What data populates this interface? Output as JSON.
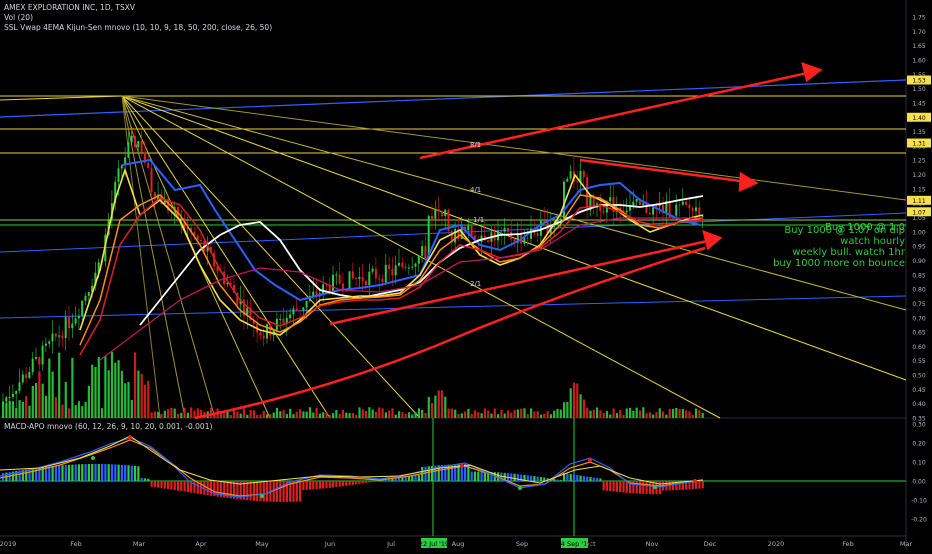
{
  "header": {
    "symbol": "AMEX EXPLORATION INC, 1D, TSXV",
    "vol": "Vol (20)",
    "ssl": "SSL Vwap 4EMA Kijun-Sen mnovo (10, 10, 9, 18, 50, 200, close, 26, 50)",
    "macd": "MACD-APO mnovo (60, 12, 26, 9, 10, 20, 0.001, -0.001)"
  },
  "annotations": {
    "line1": "Buy 1000 @ 1.0",
    "line2": "Buy 1000 @ 1.07 on dip",
    "line3": "watch hourly",
    "line4": "weekly bull. watch 1hr",
    "line5": "buy 1000 more on bounce",
    "fan_8_1": "8/1",
    "fan_4_1": "4/1",
    "fan_2_1": "2/1",
    "fan_1_1": "1/1"
  },
  "colors": {
    "background": "#000000",
    "candle_up": "#2ecc40",
    "candle_down": "#e02020",
    "level_line": "#e6d43a",
    "trend_blue": "#2962ff",
    "arrow_red": "#ff2020",
    "annotation_green": "#2ecc40",
    "price_label_bg": "#f6e04c",
    "date_label_bg": "#2ecc40"
  },
  "chart_data": {
    "type": "line",
    "title": "AMEX EXPLORATION INC, 1D, TSXV",
    "y_price_ticks": [
      "1.75",
      "1.70",
      "1.65",
      "1.60",
      "1.55",
      "1.50",
      "1.45",
      "1.40",
      "1.35",
      "1.30",
      "1.25",
      "1.20",
      "1.15",
      "1.10",
      "1.05",
      "1.00",
      "0.95",
      "0.90",
      "0.85",
      "0.80",
      "0.75",
      "0.70",
      "0.65",
      "0.60",
      "0.55",
      "0.50",
      "0.45",
      "0.40",
      "0.35"
    ],
    "ylim": [
      0.35,
      1.78
    ],
    "highlighted_price_labels": [
      {
        "text": "1.53",
        "value": 1.53
      },
      {
        "text": "1.40",
        "value": 1.4
      },
      {
        "text": "1.31",
        "value": 1.31
      },
      {
        "text": "1.11",
        "value": 1.11
      },
      {
        "text": "1.07",
        "value": 1.07
      }
    ],
    "macd_ticks": [
      "0.30",
      "0.20",
      "0.10",
      "0.00",
      "-0.10",
      "-0.20"
    ],
    "macd_ylim": [
      -0.24,
      0.32
    ],
    "x_labels": [
      "2019",
      "Feb",
      "Mar",
      "Apr",
      "May",
      "Jun",
      "Jul",
      "Aug",
      "Sep",
      "Oct",
      "Nov",
      "Dec",
      "2020",
      "Feb",
      "Mar"
    ],
    "date_highlights": [
      "22 Jul '19",
      "24 Sep '19"
    ],
    "series": [
      {
        "name": "Close",
        "x": [
          "Jan",
          "Feb",
          "Mar",
          "Apr",
          "May",
          "Jun",
          "Jul",
          "Aug",
          "Sep",
          "Oct",
          "Nov"
        ],
        "values": [
          0.4,
          0.72,
          1.2,
          0.95,
          0.64,
          0.82,
          0.86,
          1.0,
          0.98,
          1.1,
          1.08
        ]
      }
    ]
  }
}
